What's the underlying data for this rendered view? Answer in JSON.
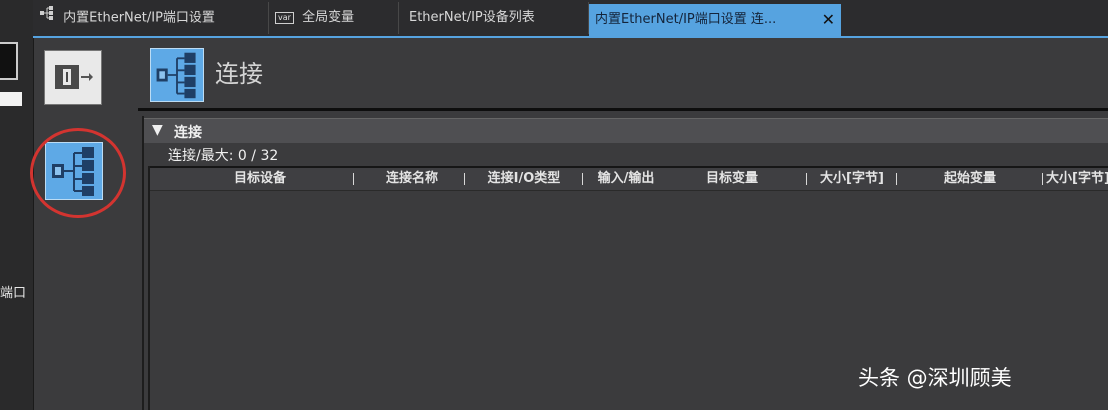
{
  "left_strip": {
    "cut_text": "端口"
  },
  "tabs": [
    {
      "label": "内置EtherNet/IP端口设置",
      "icon": "tree-network-icon",
      "active": false
    },
    {
      "label": "全局变量",
      "icon": "var-badge-icon",
      "badge": "var",
      "active": false
    },
    {
      "label": "EtherNet/IP设备列表",
      "active": false
    },
    {
      "label": "内置EtherNet/IP端口设置 连...",
      "active": true,
      "close": "✕"
    }
  ],
  "header": {
    "title": "连接",
    "icon": "connection-tree-icon"
  },
  "panel": {
    "toggle": "▼",
    "title": "连接",
    "count_label": "连接/最大:",
    "count_value": "0",
    "count_sep": "/",
    "count_max": "32"
  },
  "columns": [
    "目标设备",
    "连接名称",
    "连接I/O类型",
    "输入/输出",
    "目标变量",
    "大小[字节]",
    "起始变量",
    "大小[字节]"
  ],
  "rows": [],
  "watermark": "头条 @深圳顾美",
  "colors": {
    "accent": "#56a3e0",
    "icon_blue": "#5ea9e6",
    "background": "#3b3b3d",
    "highlight_circle": "#d33430"
  }
}
